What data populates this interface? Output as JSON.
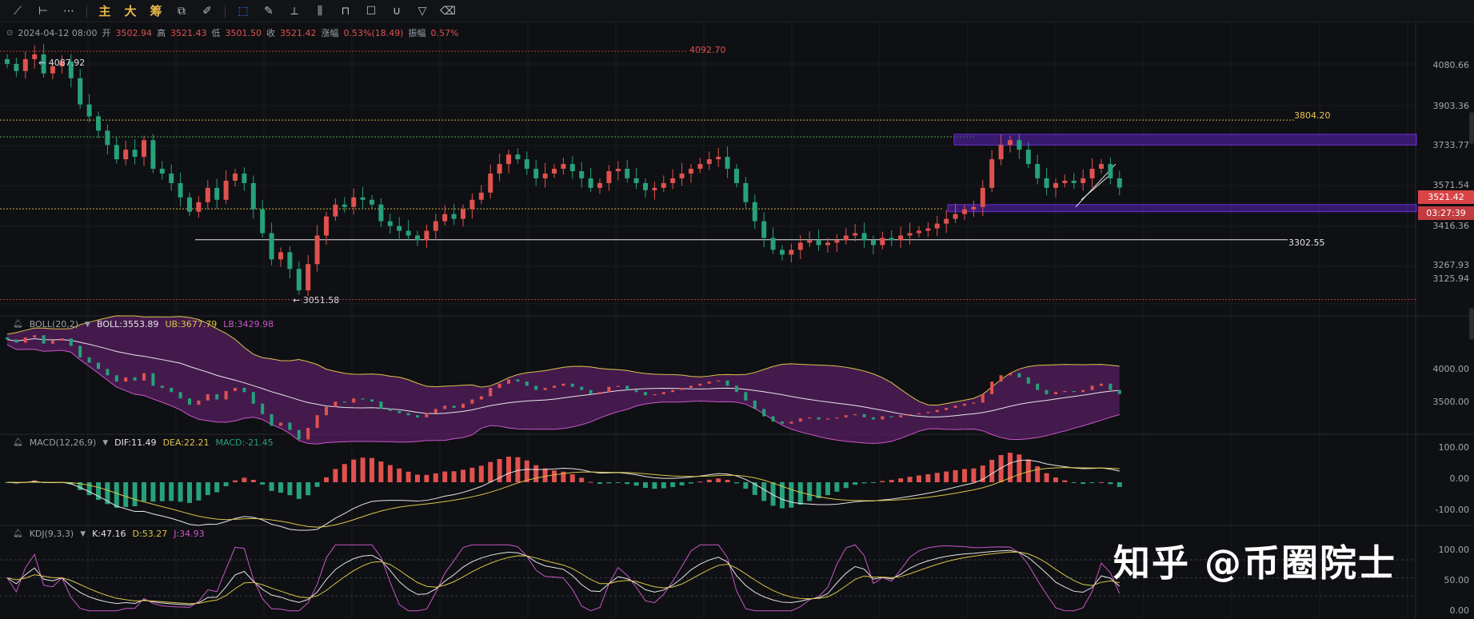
{
  "toolbar": {
    "tools": [
      {
        "name": "trendline-icon",
        "glyph": "⟋"
      },
      {
        "name": "horizontal-ray-icon",
        "glyph": "⊢"
      },
      {
        "name": "more-dots-icon",
        "glyph": "⋯"
      }
    ],
    "text_buttons": [
      "主",
      "大",
      "筹"
    ],
    "right_tools": [
      {
        "name": "indicator-icon",
        "glyph": "⧉"
      },
      {
        "name": "pen-icon",
        "glyph": "✎"
      },
      {
        "name": "select-icon",
        "glyph": "⬚"
      },
      {
        "name": "ruler-icon",
        "glyph": "⟂"
      },
      {
        "name": "brush-icon",
        "glyph": "✐"
      },
      {
        "name": "compare-icon",
        "glyph": "⫼"
      },
      {
        "name": "lock-icon",
        "glyph": "⊓"
      },
      {
        "name": "note-icon",
        "glyph": "☐"
      },
      {
        "name": "magnet-icon",
        "glyph": "∪"
      },
      {
        "name": "filter-icon",
        "glyph": "▽"
      },
      {
        "name": "trash-icon",
        "glyph": "🗑"
      }
    ]
  },
  "info": {
    "datetime": "2024-04-12 08:00",
    "open_label": "开",
    "open": "3502.94",
    "high_label": "高",
    "high": "3521.43",
    "low_label": "低",
    "low": "3501.50",
    "close_label": "收",
    "close": "3521.42",
    "change_label": "涨幅",
    "change": "0.53%(18.49)",
    "amplitude_label": "振幅",
    "amplitude": "0.57%"
  },
  "main": {
    "axis_labels": [
      "4080.66",
      "3903.36",
      "3733.77",
      "3571.54",
      "3416.36",
      "3267.93",
      "3125.94"
    ],
    "current_price": "3521.42",
    "countdown": "03:27:39",
    "annotations": {
      "high_level": "4092.70",
      "high_marker": "← 4087.92",
      "low_marker": "← 3051.58",
      "resistance": "3804.20",
      "support": "3302.55"
    }
  },
  "boll": {
    "name": "BOLL(20,2)",
    "boll_label": "BOLL:3553.89",
    "ub_label": "UB:3677.79",
    "lb_label": "LB:3429.98",
    "axis_labels": [
      "4000.00",
      "3500.00"
    ]
  },
  "macd": {
    "name": "MACD(12,26,9)",
    "dif_label": "DIF:11.49",
    "dea_label": "DEA:22.21",
    "macd_label": "MACD:-21.45",
    "axis_labels": [
      "100.00",
      "0.00",
      "-100.00"
    ]
  },
  "kdj": {
    "name": "KDJ(9,3,3)",
    "k_label": "K:47.16",
    "d_label": "D:53.27",
    "j_label": "J:34.93",
    "axis_labels": [
      "100.00",
      "50.00",
      "0.00"
    ]
  },
  "watermark": "知乎 @币圈院士",
  "colors": {
    "up": "#e0524f",
    "down": "#26a17b",
    "zone": "#6a2cd8",
    "ub": "#d8c44a",
    "lb": "#c957c9"
  },
  "chart_data": {
    "type": "candlestick",
    "price_range": [
      3050,
      4100
    ],
    "closes": [
      4040,
      4010,
      4060,
      4080,
      4000,
      4030,
      4050,
      3980,
      3870,
      3820,
      3760,
      3700,
      3640,
      3680,
      3650,
      3720,
      3600,
      3580,
      3540,
      3480,
      3420,
      3460,
      3520,
      3470,
      3550,
      3580,
      3540,
      3430,
      3330,
      3220,
      3250,
      3180,
      3090,
      3200,
      3320,
      3400,
      3450,
      3440,
      3480,
      3470,
      3450,
      3380,
      3360,
      3340,
      3320,
      3300,
      3340,
      3380,
      3410,
      3390,
      3430,
      3470,
      3500,
      3580,
      3620,
      3660,
      3640,
      3600,
      3560,
      3580,
      3600,
      3620,
      3590,
      3560,
      3520,
      3540,
      3590,
      3600,
      3560,
      3540,
      3510,
      3520,
      3540,
      3560,
      3580,
      3600,
      3620,
      3640,
      3650,
      3600,
      3540,
      3460,
      3380,
      3310,
      3260,
      3240,
      3260,
      3290,
      3300,
      3280,
      3290,
      3300,
      3320,
      3330,
      3300,
      3280,
      3310,
      3300,
      3320,
      3330,
      3340,
      3350,
      3370,
      3390,
      3410,
      3430,
      3440,
      3520,
      3640,
      3700,
      3720,
      3680,
      3620,
      3560,
      3520,
      3540,
      3550,
      3540,
      3560,
      3600,
      3620,
      3560,
      3521
    ]
  }
}
